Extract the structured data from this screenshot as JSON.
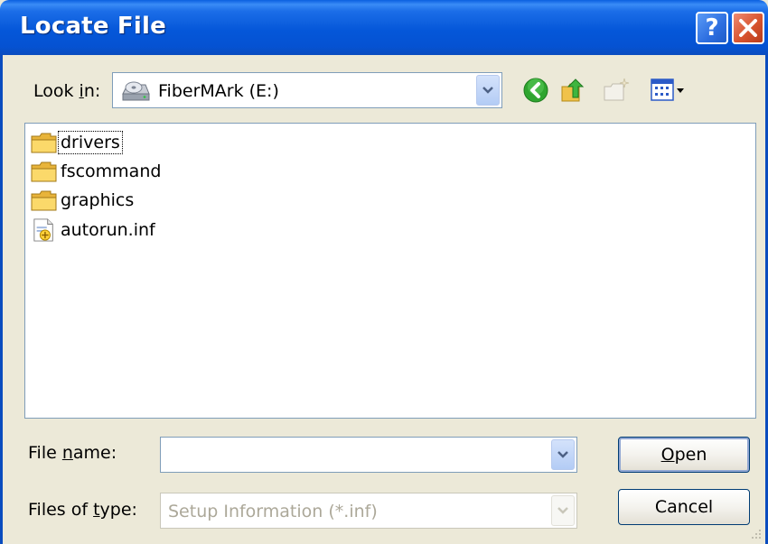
{
  "window": {
    "title": "Locate File",
    "help_icon": "question-mark-icon",
    "close_icon": "close-x-icon"
  },
  "lookin": {
    "label_pre": "Look ",
    "label_accel": "i",
    "label_post": "n:",
    "value": "FiberMArk (E:)",
    "drive_icon": "cd-drive-icon"
  },
  "toolbar": {
    "icons": [
      "back-icon",
      "up-folder-icon",
      "new-folder-icon",
      "views-menu-icon"
    ]
  },
  "files": [
    {
      "name": "drivers",
      "icon": "folder-icon"
    },
    {
      "name": "fscommand",
      "icon": "folder-icon"
    },
    {
      "name": "graphics",
      "icon": "folder-icon"
    },
    {
      "name": "autorun.inf",
      "icon": "setup-info-file-icon"
    }
  ],
  "filename": {
    "label_pre": "File ",
    "label_accel": "n",
    "label_post": "ame:",
    "value": ""
  },
  "filetype": {
    "label_pre": "Files of ",
    "label_accel": "t",
    "label_post": "ype:",
    "value": "Setup Information (*.inf)"
  },
  "buttons": {
    "open_accel": "O",
    "open_rest": "pen",
    "cancel": "Cancel"
  }
}
